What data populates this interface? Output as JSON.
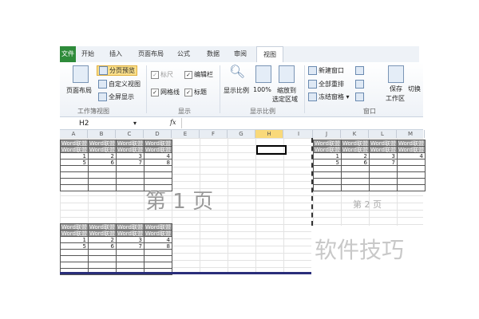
{
  "tabs": {
    "file": "文件",
    "items": [
      "开始",
      "插入",
      "页面布局",
      "公式",
      "数据",
      "审阅",
      "视图"
    ],
    "active": "视图"
  },
  "ribbon": {
    "workbook_views": {
      "page_layout": "页面布局",
      "page_break_preview": "分页预览",
      "custom_views": "自定义视图",
      "full_screen": "全屏显示",
      "group": "工作簿视图"
    },
    "show": {
      "ruler": "标尺",
      "formula_bar": "编辑栏",
      "gridlines": "网格线",
      "headings": "标题",
      "group": "显示"
    },
    "zoom": {
      "zoom": "显示比例",
      "hundred": "100%",
      "zoom_sel_1": "缩放到",
      "zoom_sel_2": "选定区域",
      "group": "显示比例"
    },
    "window": {
      "new_window": "新建窗口",
      "arrange_all": "全部重排",
      "freeze_panes": "冻结窗格",
      "save_ws_1": "保存",
      "save_ws_2": "工作区",
      "switch": "切换",
      "group": "窗口"
    }
  },
  "formula_bar": {
    "name_box": "H2",
    "fx": "fx"
  },
  "columns": [
    "A",
    "B",
    "C",
    "D",
    "E",
    "F",
    "G",
    "H",
    "I",
    "J",
    "K",
    "L",
    "M"
  ],
  "selected_column": "H",
  "table": {
    "header": "Word联盟",
    "row1": [
      "1",
      "2",
      "3",
      "4"
    ],
    "row2": [
      "5",
      "6",
      "7",
      "8"
    ]
  },
  "page2_row2": [
    "5",
    "6",
    "7",
    ""
  ],
  "page_labels": {
    "page1": "第 1 页",
    "page2": "第 2 页"
  },
  "watermark": "软件技巧"
}
